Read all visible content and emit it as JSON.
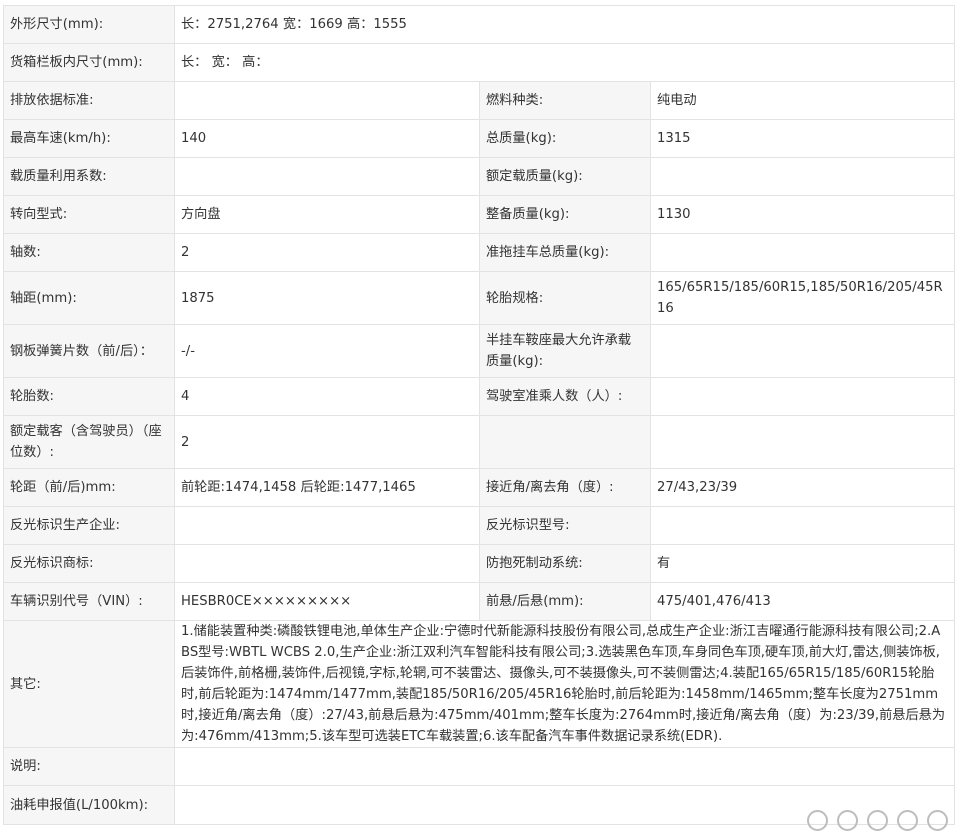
{
  "rows": [
    {
      "type": "wide",
      "label": "外形尺寸(mm):",
      "value": "长：2751,2764 宽：1669 高：1555"
    },
    {
      "type": "wide",
      "label": "货箱栏板内尺寸(mm):",
      "value": "长：  宽：  高："
    },
    {
      "type": "pair",
      "l1": "排放依据标准:",
      "v1": "",
      "l2": "燃料种类:",
      "v2": "纯电动"
    },
    {
      "type": "pair",
      "l1": "最高车速(km/h):",
      "v1": "140",
      "l2": "总质量(kg):",
      "v2": "1315"
    },
    {
      "type": "pair",
      "l1": "载质量利用系数:",
      "v1": "",
      "l2": "额定载质量(kg):",
      "v2": ""
    },
    {
      "type": "pair",
      "l1": "转向型式:",
      "v1": "方向盘",
      "l2": "整备质量(kg):",
      "v2": "1130"
    },
    {
      "type": "pair",
      "l1": "轴数:",
      "v1": "2",
      "l2": "准拖挂车总质量(kg):",
      "v2": ""
    },
    {
      "type": "pair",
      "l1": "轴距(mm):",
      "v1": "1875",
      "l2": "轮胎规格:",
      "v2": "165/65R15/185/60R15,185/50R16/205/45R16"
    },
    {
      "type": "pair",
      "l1": "钢板弹簧片数（前/后）：",
      "v1": "-/-",
      "l2": "半挂车鞍座最大允许承载质量(kg):",
      "v2": ""
    },
    {
      "type": "pair",
      "l1": "轮胎数:",
      "v1": "4",
      "l2": "驾驶室准乘人数（人）:",
      "v2": ""
    },
    {
      "type": "pair",
      "l1": "额定载客（含驾驶员）（座位数）:",
      "v1": "2",
      "l2": "",
      "v2": ""
    },
    {
      "type": "pair",
      "l1": "轮距（前/后)mm:",
      "v1": "前轮距:1474,1458 后轮距:1477,1465",
      "l2": "接近角/离去角（度）:",
      "v2": "27/43,23/39"
    },
    {
      "type": "pair",
      "l1": "反光标识生产企业:",
      "v1": "",
      "l2": "反光标识型号:",
      "v2": ""
    },
    {
      "type": "pair",
      "l1": "反光标识商标:",
      "v1": "",
      "l2": "防抱死制动系统:",
      "v2": "有"
    },
    {
      "type": "pair",
      "l1": "车辆识别代号（VIN）:",
      "v1": "HESBR0CE×××××××××",
      "l2": "前悬/后悬(mm):",
      "v2": "475/401,476/413"
    },
    {
      "type": "wide",
      "label": "其它:",
      "value": "1.储能装置种类:磷酸铁锂电池,单体生产企业:宁德时代新能源科技股份有限公司,总成生产企业:浙江吉曜通行能源科技有限公司;2.ABS型号:WBTL WCBS 2.0,生产企业:浙江双利汽车智能科技有限公司;3.选装黑色车顶,车身同色车顶,硬车顶,前大灯,雷达,侧装饰板,后装饰件,前格栅,装饰件,后视镜,字标,轮辋,可不装雷达、摄像头,可不装摄像头,可不装侧雷达;4.装配165/65R15/185/60R15轮胎时,前后轮距为:1474mm/1477mm,装配185/50R16/205/45R16轮胎时,前后轮距为:1458mm/1465mm;整车长度为2751mm时,接近角/离去角（度）:27/43,前悬后悬为:475mm/401mm;整车长度为:2764mm时,接近角/离去角（度）为:23/39,前悬后悬为为:476mm/413mm;5.该车型可选装ETC车载装置;6.该车配备汽车事件数据记录系统(EDR)."
    },
    {
      "type": "wide",
      "label": "说明:",
      "value": ""
    },
    {
      "type": "wide",
      "label": "油耗申报值(L/100km):",
      "value": ""
    }
  ]
}
